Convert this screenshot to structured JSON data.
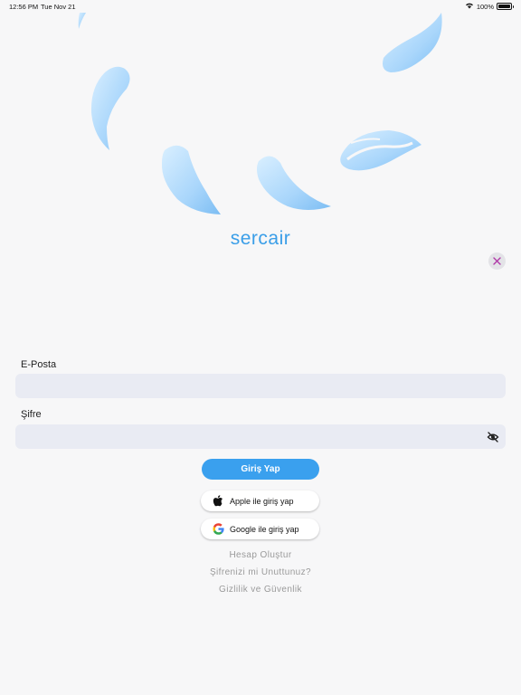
{
  "status_bar": {
    "time": "12:56 PM",
    "date": "Tue Nov 21",
    "battery": "100%"
  },
  "brand": {
    "name": "sercair",
    "color": "#3a9ee8"
  },
  "form": {
    "email_label": "E-Posta",
    "email_value": "",
    "password_label": "Şifre",
    "password_value": "",
    "login_label": "Giriş Yap"
  },
  "social": {
    "apple_label": "Apple ile giriş yap",
    "google_label": "Google ile giriş yap"
  },
  "links": {
    "create_account": "Hesap Oluştur",
    "forgot_password": "Şifrenizi mi Unuttunuz?",
    "privacy": "Gizlilik ve Güvenlik"
  },
  "icons": {
    "close": "close-icon",
    "password_visibility": "eye-off-icon",
    "apple": "apple-icon",
    "google": "google-icon"
  },
  "colors": {
    "accent": "#3aa0ee",
    "field_bg": "#e9ebf3",
    "close_x": "#b03aa8"
  }
}
